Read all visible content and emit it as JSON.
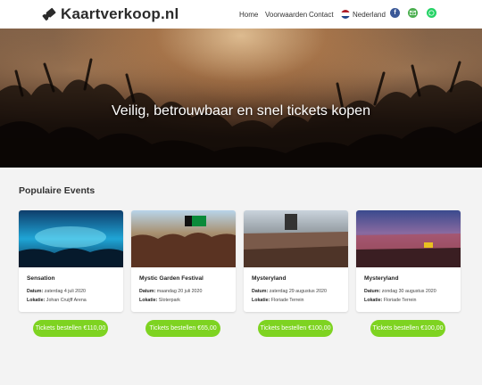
{
  "header": {
    "logo_text": "Kaartverkoop.nl",
    "nav": {
      "home": "Home",
      "voorwaarden": "Voorwaarden",
      "contact": "Contact",
      "language": "Nederland"
    },
    "social_icons": [
      "facebook-icon",
      "mail-icon",
      "whatsapp-icon"
    ]
  },
  "hero": {
    "title": "Veilig, betrouwbaar en snel tickets kopen"
  },
  "events_section": {
    "title": "Populaire Events",
    "date_label": "Datum:",
    "location_label": "Lokatie:",
    "events": [
      {
        "name": "Sensation",
        "date": "zaterdag 4 juli 2020",
        "location": "Johan Cruijff Arena",
        "button": "Tickets bestellen €110,00"
      },
      {
        "name": "Mystic Garden Festival",
        "date": "maandag 20 juli 2020",
        "location": "Sloterpark",
        "button": "Tickets bestellen €65,00"
      },
      {
        "name": "Mysteryland",
        "date": "zaterdag 29 augustus 2020",
        "location": "Floriade Terrein",
        "button": "Tickets bestellen €100,00"
      },
      {
        "name": "Mysteryland",
        "date": "zondag 30 augustus 2020",
        "location": "Floriade Terrein",
        "button": "Tickets bestellen €100,00"
      }
    ]
  },
  "colors": {
    "button_green": "#7ed321",
    "facebook": "#3b5998",
    "whatsapp": "#25d366"
  }
}
